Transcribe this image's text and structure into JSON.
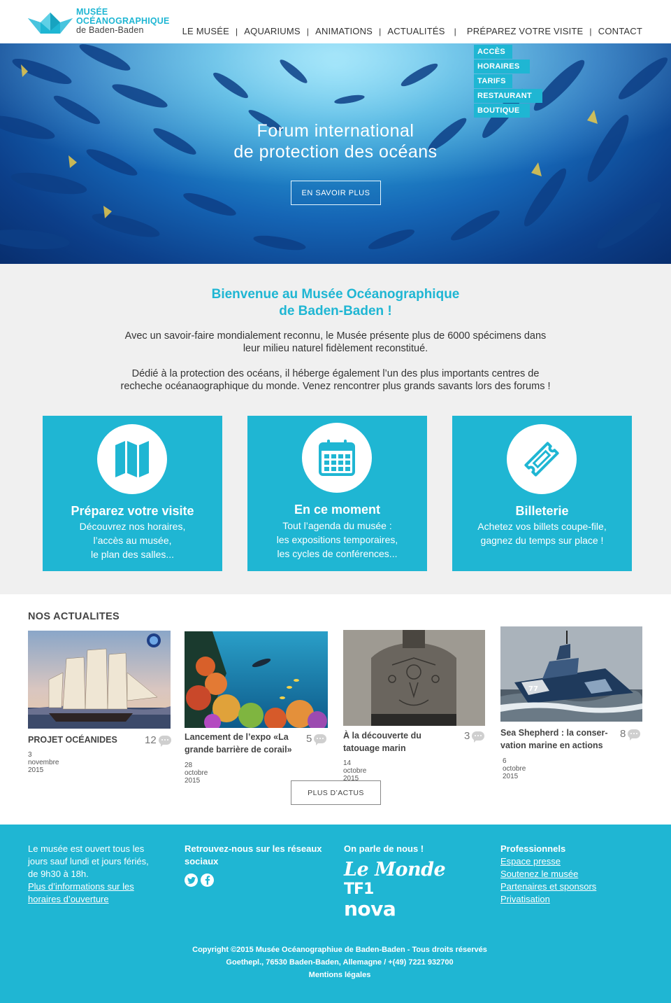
{
  "header": {
    "logo": {
      "line1": "MUSÉE",
      "line2": "OCÉANOGRAPHIQUE",
      "line3": "de Baden-Baden"
    },
    "nav": [
      "LE MUSÉE",
      "AQUARIUMS",
      "ANIMATIONS",
      "ACTUALITÉS",
      "PRÉPAREZ VOTRE VISITE",
      "CONTACT"
    ],
    "dropdown": [
      "ACCÈS",
      "HORAIRES",
      "TARIFS",
      "RESTAURANT",
      "BOUTIQUE"
    ]
  },
  "hero": {
    "title_line1": "Forum international",
    "title_line2": "de protection des océans",
    "button": "EN SAVOIR PLUS"
  },
  "welcome": {
    "title_line1": "Bienvenue au Musée Océanographique",
    "title_line2": "de Baden-Baden !",
    "p1_line1": "Avec un savoir-faire mondialement reconnu, le Musée présente plus de 6000 spécimens dans",
    "p1_line2": "leur milieu naturel fidèlement reconstitué.",
    "p2_line1": "Dédié à la protection des océans, il héberge également l’un des plus importants centres de",
    "p2_line2": "recheche océanaographique du monde. Venez rencontrer plus grands savants lors des forums !"
  },
  "cards": [
    {
      "icon": "map-icon",
      "title": "Préparez votre visite",
      "lines": [
        "Découvrez nos horaires,",
        "l’accès au musée,",
        "le plan des salles..."
      ]
    },
    {
      "icon": "calendar-icon",
      "title": "En ce moment",
      "lines": [
        "Tout l’agenda du musée :",
        "les expositions temporaires,",
        "les cycles de conférences..."
      ]
    },
    {
      "icon": "ticket-icon",
      "title": "Billeterie",
      "lines": [
        "Achetez vos billets coupe-file,",
        "gagnez du temps sur place !"
      ]
    }
  ],
  "news": {
    "title": "NOS ACTUALITES",
    "articles": [
      {
        "title_line1": "PROJET OCÉANIDES",
        "title_line2": "",
        "date": "3 novembre 2015",
        "comments": "12"
      },
      {
        "title_line1": "Lancement de l’expo «La",
        "title_line2": "grande barrière de corail»",
        "date": "28 octobre 2015",
        "comments": "5"
      },
      {
        "title_line1": "À la découverte du",
        "title_line2": "tatouage marin",
        "date": "14 octobre 2015",
        "comments": "3"
      },
      {
        "title_line1": "Sea Shepherd : la conser-",
        "title_line2": "vation marine en actions",
        "date": "6 octobre 2015",
        "comments": "8"
      }
    ],
    "more_button": "PLUS D’ACTUS"
  },
  "footer": {
    "hours_lines": [
      "Le musée est ouvert tous les",
      "jours sauf lundi et jours fériés,",
      "de 9h30 à 18h."
    ],
    "hours_link_line1": "Plus d’informations sur les",
    "hours_link_line2": "horaires d’ouverture",
    "social_title_line1": "Retrouvez-nous sur les réseaux",
    "social_title_line2": "sociaux",
    "press_title": "On parle de nous !",
    "press": [
      "Le Monde",
      "TF1",
      "nova"
    ],
    "pro_title": "Professionnels",
    "pro_links": [
      "Espace presse",
      "Soutenez le musée",
      "Partenaires et sponsors",
      "Privatisation"
    ],
    "copyright_line1": "Copyright ©2015  Musée Océanographiue de Baden-Baden - Tous droits réservés",
    "copyright_line2": "Goethepl., 76530 Baden-Baden, Allemagne / +(49) 7221 932700",
    "legal": "Mentions légales"
  },
  "colors": {
    "accent": "#1fb6d3",
    "background": "#f0f0f0"
  }
}
